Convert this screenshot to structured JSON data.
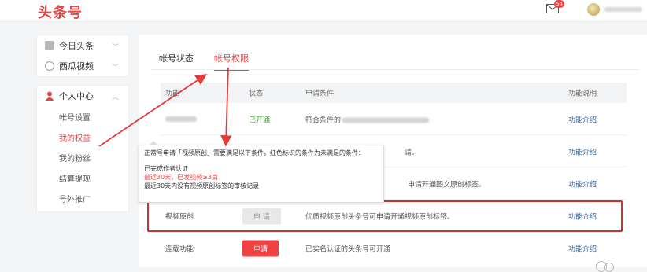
{
  "app": {
    "logo": "头条号",
    "mail_badge": "54"
  },
  "sidebar": {
    "top_items": [
      {
        "label": "今日头条",
        "icon": "toutiao-icon"
      },
      {
        "label": "西瓜视频",
        "icon": "xigua-icon"
      }
    ],
    "personal": {
      "label": "个人中心",
      "sub_items": [
        "帐号设置",
        "我的权益",
        "我的粉丝",
        "结算提现",
        "号外推广"
      ],
      "active": "我的权益"
    }
  },
  "tabs": [
    "帐号状态",
    "帐号权限"
  ],
  "active_tab": "帐号权限",
  "table": {
    "headers": [
      "功能",
      "状态",
      "申请条件",
      "功能说明"
    ],
    "rows": [
      {
        "status": "已开通",
        "condition": "符合条件的",
        "link": "功能介绍"
      },
      {
        "condition_tail": "请。",
        "link": "功能介绍"
      },
      {
        "condition_tail": "申请开通图文原创标签。",
        "link": "功能介绍"
      },
      {
        "name": "视频原创",
        "button": "申 请",
        "condition": "优质视频原创头条号可申请开通视频原创标签。",
        "link": "功能介绍"
      },
      {
        "name": "连载功能",
        "button": "申请",
        "condition": "已实名认证的头条号可开通",
        "link": "功能介绍"
      }
    ]
  },
  "tooltip": {
    "line1": "正常号申请「视频原创」需要满足以下条件，红色标识的条件为未满足的条件：",
    "line2": "已完成作者认证",
    "line3": "最近30天，已发视频≥3篇",
    "line4": "最近30天内没有视频原创标签的审核记录"
  },
  "colors": {
    "brand": "#e64545",
    "link": "#406599",
    "open": "#2aa515",
    "annotation": "#e03c3c"
  }
}
